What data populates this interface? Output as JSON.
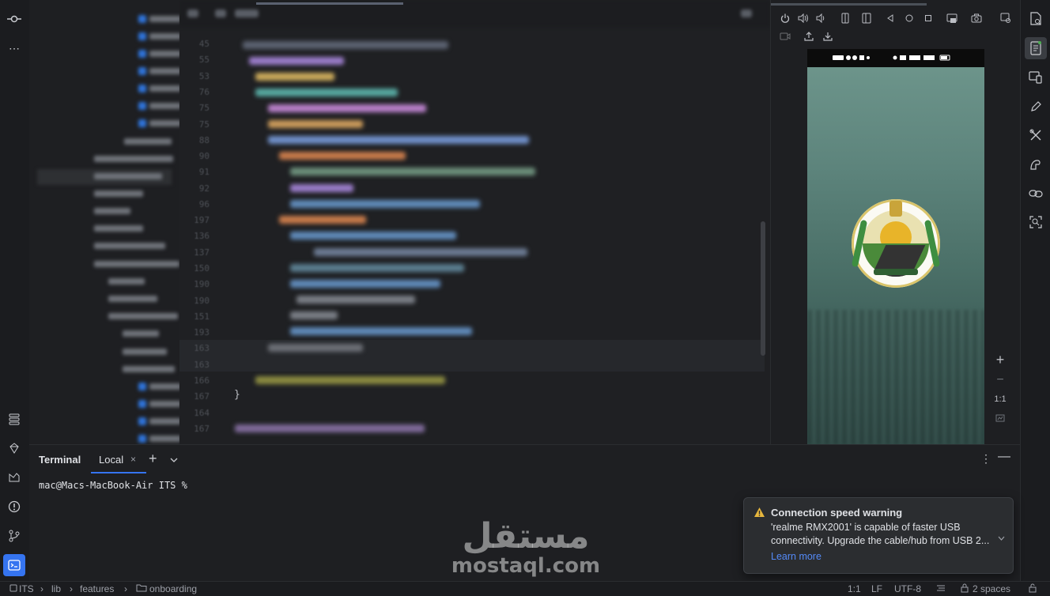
{
  "terminal": {
    "title": "Terminal",
    "tab_local": "Local",
    "tab_close": "×",
    "add": "+",
    "dropdown": "⌄",
    "prompt": "mac@Macs-MacBook-Air ITS %"
  },
  "editor": {
    "line_numbers": [
      "45",
      "55",
      "53",
      "76",
      "75",
      "75",
      "88",
      "90",
      "91",
      "92",
      "96",
      "197",
      "136",
      "137",
      "150",
      "190",
      "190",
      "151",
      "193",
      "163",
      "163",
      "166",
      "167",
      "164",
      "167"
    ],
    "closing_brace": "}"
  },
  "device_panel": {
    "zoom_label": "1:1"
  },
  "notification": {
    "title": "Connection speed warning",
    "body": "'realme RMX2001' is capable of faster USB connectivity. Upgrade the cable/hub from USB 2...",
    "link": "Learn more"
  },
  "watermark": {
    "arabic": "مستقل",
    "latin": "mostaql.com"
  },
  "breadcrumb": {
    "items": [
      "ITS",
      "lib",
      "features",
      "onboarding"
    ],
    "separator": "›"
  },
  "status": {
    "position": "1:1",
    "line_sep": "LF",
    "encoding": "UTF-8",
    "indent": "2 spaces"
  },
  "colors": {
    "accent": "#3574f0",
    "warning": "#e6b63d",
    "link": "#548af7"
  }
}
